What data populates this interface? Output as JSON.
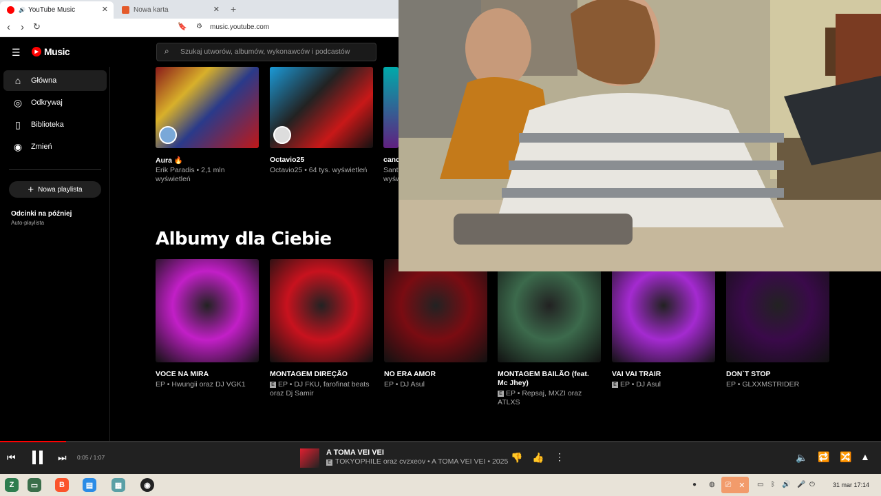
{
  "browser": {
    "tabs": [
      {
        "label": "YouTube Music",
        "active": true
      },
      {
        "label": "Nowa karta",
        "active": false
      }
    ],
    "url": "music.youtube.com"
  },
  "app": {
    "logo_text": "Music",
    "search_placeholder": "Szukaj utworów, albumów, wykonawców i podcastów"
  },
  "sidebar": {
    "items": [
      {
        "label": "Główna",
        "icon": "home-icon",
        "active": true
      },
      {
        "label": "Odkrywaj",
        "icon": "explore-icon",
        "active": false
      },
      {
        "label": "Biblioteka",
        "icon": "library-icon",
        "active": false
      },
      {
        "label": "Zmień",
        "icon": "upgrade-icon",
        "active": false
      }
    ],
    "new_playlist": "Nowa playlista",
    "playlist_title": "Odcinki na później",
    "playlist_sub": "Auto-playlista"
  },
  "artists_row": [
    {
      "title": "Aura 🔥",
      "sub": "Erik Paradis • 2,1 mln wyświetleń"
    },
    {
      "title": "Octavio25",
      "sub": "Octavio25 • 64 tys. wyświetleń"
    },
    {
      "title": "cand",
      "sub": "Sant wyśw"
    }
  ],
  "section_title": "Albumy dla Ciebie",
  "albums": [
    {
      "title": "VOCE NA MIRA",
      "sub": "EP • Hwungii oraz DJ VGK1",
      "explicit": false,
      "color": "#c21fc7"
    },
    {
      "title": "MONTAGEM DIREÇÃO",
      "sub": "EP • DJ FKU, farofinat beats oraz Dj Samir",
      "explicit": true,
      "color": "#c8121e"
    },
    {
      "title": "NO ERA AMOR",
      "sub": "EP • DJ Asul",
      "explicit": false,
      "color": "#7a0c12"
    },
    {
      "title": "MONTAGEM BAILÃO (feat. Mc Jhey)",
      "sub": "EP • Repsaj, MXZI oraz ATLXS",
      "explicit": true,
      "color": "#3c6a4c"
    },
    {
      "title": "VAI VAI TRAIR",
      "sub": "EP • DJ Asul",
      "explicit": true,
      "color": "#a42ad0"
    },
    {
      "title": "DON`T STOP",
      "sub": "EP • GLXXMSTRIDER",
      "explicit": false,
      "color": "#3a0a4a"
    }
  ],
  "player": {
    "time": "0:05 / 1:07",
    "progress": 0.075,
    "title": "A TOMA VEI VEI",
    "subtitle": "TOKYOPHILE oraz cvzxeov • A TOMA VEI VEI • 2025"
  },
  "taskbar": {
    "clock": "31 mar  17:14"
  }
}
